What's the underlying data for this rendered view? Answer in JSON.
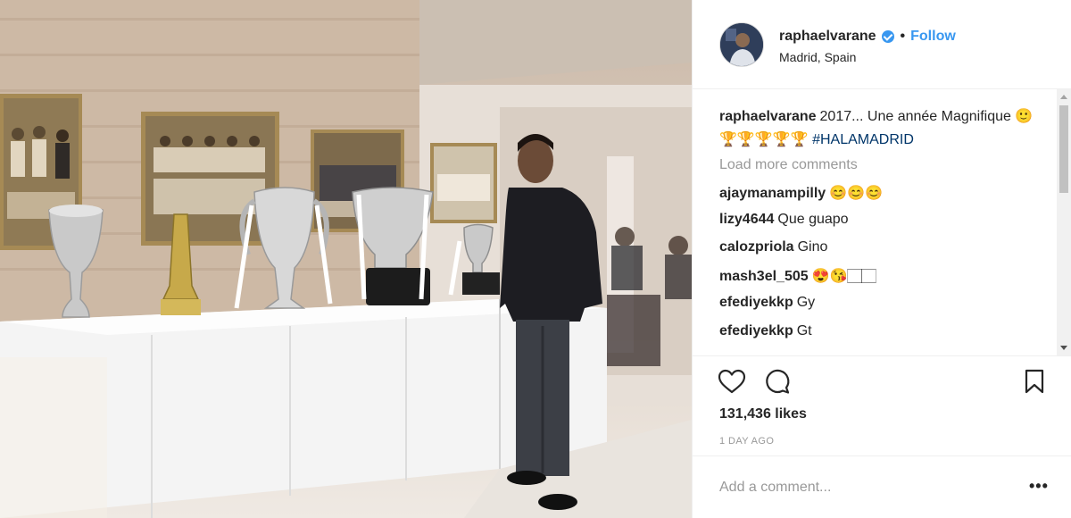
{
  "post": {
    "username": "raphaelvarane",
    "separator": "•",
    "follow_label": "Follow",
    "location": "Madrid, Spain",
    "caption_text": "2017... Une année Magnifique 🙂🏆🏆🏆🏆🏆",
    "caption_hashtag": "#HALAMADRID",
    "load_more_label": "Load more comments",
    "comments": [
      {
        "user": "ajaymanampilly",
        "text": "😊😊😊"
      },
      {
        "user": "lizy4644",
        "text": "Que guapo"
      },
      {
        "user": "calozpriola",
        "text": "Gino"
      },
      {
        "user": "mash3el_505",
        "text": "😍😘🏻🏻"
      },
      {
        "user": "efediyekkp",
        "text": "Gy"
      },
      {
        "user": "efediyekkp",
        "text": "Gt"
      }
    ],
    "likes": "131,436 likes",
    "timestamp": "1 DAY AGO",
    "add_comment_placeholder": "Add a comment...",
    "more_options_label": "•••"
  },
  "colors": {
    "link_blue": "#3897f0",
    "hashtag_blue": "#003569",
    "muted_gray": "#999999",
    "text": "#262626",
    "divider": "#efefef"
  },
  "icons": [
    "heart-icon",
    "comment-icon",
    "bookmark-icon",
    "verified-badge-icon",
    "more-options-icon"
  ]
}
